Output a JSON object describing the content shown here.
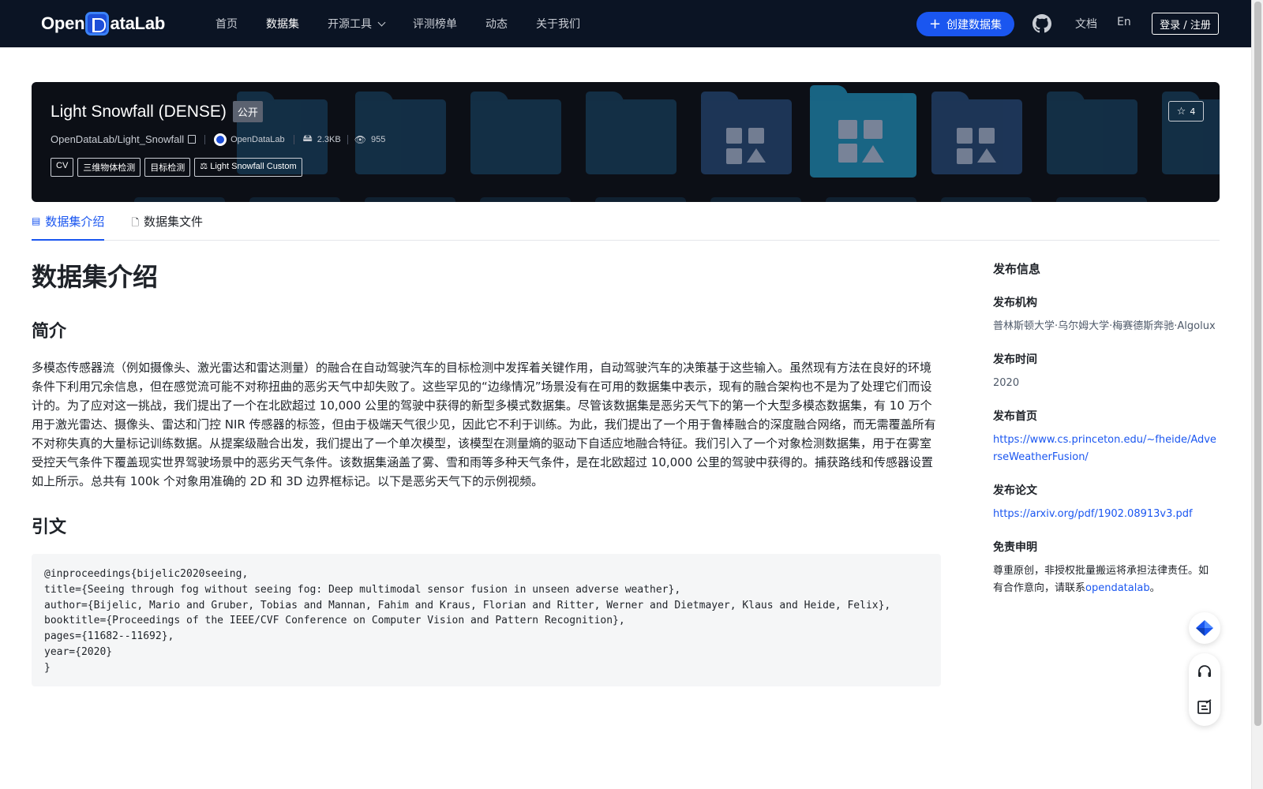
{
  "nav": {
    "logo": "OpenDataLab",
    "items": [
      {
        "label": "首页",
        "active": false
      },
      {
        "label": "数据集",
        "active": true
      },
      {
        "label": "开源工具",
        "active": false,
        "dropdown": true
      },
      {
        "label": "评测榜单",
        "active": false
      },
      {
        "label": "动态",
        "active": false
      },
      {
        "label": "关于我们",
        "active": false
      }
    ],
    "create_label": "创建数据集",
    "docs_label": "文档",
    "lang_label": "En",
    "login_label": "登录 / 注册"
  },
  "banner": {
    "title": "Light Snowfall (DENSE)",
    "visibility": "公开",
    "repo": "OpenDataLab/Light_Snowfall",
    "org": "OpenDataLab",
    "size": "2.3KB",
    "views": "955",
    "tags": [
      "CV",
      "三维物体检测",
      "目标检测"
    ],
    "license": "Light Snowfall Custom",
    "stars": "4"
  },
  "tabs": [
    {
      "label": "数据集介绍",
      "active": true
    },
    {
      "label": "数据集文件",
      "active": false
    }
  ],
  "content": {
    "heading": "数据集介绍",
    "intro_heading": "简介",
    "intro": "多模态传感器流（例如摄像头、激光雷达和雷达测量）的融合在自动驾驶汽车的目标检测中发挥着关键作用，自动驾驶汽车的决策基于这些输入。虽然现有方法在良好的环境条件下利用冗余信息，但在感觉流可能不对称扭曲的恶劣天气中却失败了。这些罕见的“边缘情况”场景没有在可用的数据集中表示，现有的融合架构也不是为了处理它们而设计的。为了应对这一挑战，我们提出了一个在北欧超过 10,000 公里的驾驶中获得的新型多模式数据集。尽管该数据集是恶劣天气下的第一个大型多模态数据集，有 10 万个用于激光雷达、摄像头、雷达和门控 NIR 传感器的标签，但由于极端天气很少见，因此它不利于训练。为此，我们提出了一个用于鲁棒融合的深度融合网络，而无需覆盖所有不对称失真的大量标记训练数据。从提案级融合出发，我们提出了一个单次模型，该模型在测量熵的驱动下自适应地融合特征。我们引入了一个对象检测数据集，用于在雾室受控天气条件下覆盖现实世界驾驶场景中的恶劣天气条件。该数据集涵盖了雾、雪和雨等多种天气条件，是在北欧超过 10,000 公里的驾驶中获得的。捕获路线和传感器设置如上所示。总共有 100k 个对象用准确的 2D 和 3D 边界框标记。以下是恶劣天气下的示例视频。",
    "cite_heading": "引文",
    "citation": "@inproceedings{bijelic2020seeing,\ntitle={Seeing through fog without seeing fog: Deep multimodal sensor fusion in unseen adverse weather},\nauthor={Bijelic, Mario and Gruber, Tobias and Mannan, Fahim and Kraus, Florian and Ritter, Werner and Dietmayer, Klaus and Heide, Felix},\nbooktitle={Proceedings of the IEEE/CVF Conference on Computer Vision and Pattern Recognition},\npages={11682--11692},\nyear={2020}\n}"
  },
  "sidebar": {
    "title": "发布信息",
    "org_label": "发布机构",
    "org_value": "普林斯顿大学·乌尔姆大学·梅赛德斯奔驰·Algolux",
    "time_label": "发布时间",
    "time_value": "2020",
    "home_label": "发布首页",
    "home_url": "https://www.cs.princeton.edu/~fheide/AdverseWeatherFusion/",
    "paper_label": "发布论文",
    "paper_url": "https://arxiv.org/pdf/1902.08913v3.pdf",
    "disclaimer_label": "免责申明",
    "disclaimer_text": "尊重原创，非授权批量搬运将承担法律责任。如有合作意向，请联系",
    "disclaimer_link": "opendatalab",
    "disclaimer_end": "。"
  },
  "colors": {
    "nav_bg": "#0b1424",
    "accent": "#1a56f0",
    "banner_bg": "#0c0f16"
  },
  "icons": {
    "github": "github-icon",
    "star": "star-icon",
    "eye": "eye-icon",
    "disk": "disk-icon",
    "copy": "copy-icon",
    "headset": "headset-icon",
    "feedback": "feedback-icon",
    "dataset": "dataset-icon",
    "file": "file-icon"
  }
}
